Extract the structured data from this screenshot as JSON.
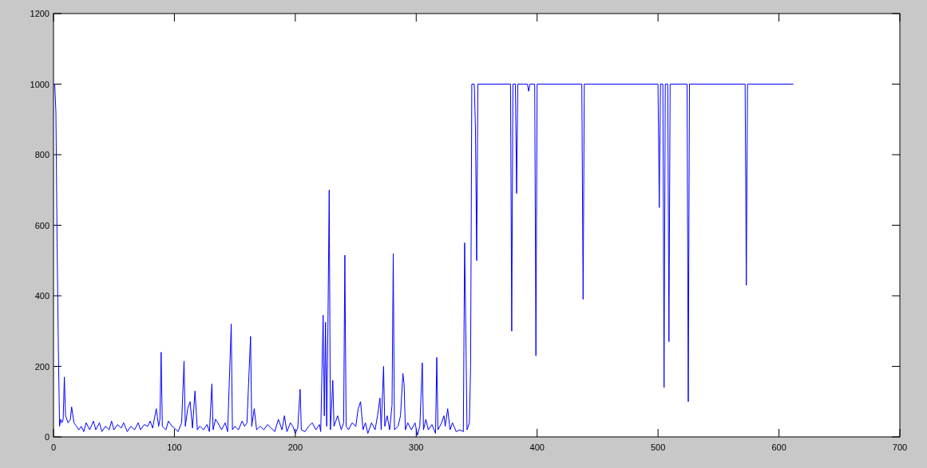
{
  "figure": {
    "chart_data": {
      "type": "line",
      "xlim": [
        0,
        700
      ],
      "ylim": [
        0,
        1200
      ],
      "xticks": [
        0,
        100,
        200,
        300,
        400,
        500,
        600,
        700
      ],
      "yticks": [
        0,
        200,
        400,
        600,
        800,
        1000,
        1200
      ],
      "x": [
        0,
        1,
        2,
        3,
        4,
        5,
        6,
        7,
        8,
        9,
        10,
        12,
        14,
        15,
        17,
        19,
        21,
        23,
        25,
        27,
        30,
        33,
        35,
        38,
        40,
        43,
        46,
        48,
        50,
        53,
        56,
        58,
        61,
        64,
        67,
        70,
        72,
        75,
        78,
        80,
        82,
        85,
        87,
        88,
        89,
        90,
        93,
        95,
        98,
        100,
        103,
        106,
        108,
        109,
        111,
        113,
        115,
        117,
        119,
        121,
        124,
        127,
        129,
        131,
        132,
        134,
        136,
        139,
        142,
        144,
        147,
        148,
        150,
        153,
        156,
        158,
        160,
        163,
        164,
        166,
        168,
        171,
        174,
        177,
        180,
        183,
        186,
        189,
        191,
        193,
        196,
        198,
        200,
        202,
        204,
        205,
        208,
        211,
        214,
        217,
        220,
        221,
        223,
        224,
        225,
        226,
        227,
        228,
        229,
        231,
        232,
        235,
        238,
        240,
        241,
        242,
        244,
        247,
        250,
        252,
        254,
        256,
        258,
        260,
        263,
        266,
        268,
        270,
        271,
        273,
        274,
        276,
        278,
        280,
        281,
        282,
        285,
        287,
        289,
        290,
        291,
        293,
        296,
        299,
        301,
        303,
        305,
        306,
        308,
        310,
        313,
        316,
        317,
        318,
        321,
        323,
        324,
        326,
        328,
        330,
        333,
        336,
        339,
        340,
        341,
        342,
        344,
        345,
        346,
        348,
        349,
        350,
        351,
        378,
        379,
        380,
        382,
        383,
        384,
        392,
        393,
        394,
        398,
        399,
        400,
        437,
        438,
        439,
        500,
        501,
        502,
        504,
        505,
        506,
        508,
        509,
        510,
        524,
        525,
        526,
        572,
        573,
        574,
        612
      ],
      "series": [
        {
          "color": "#0000ff",
          "values": [
            1000,
            1000,
            920,
            550,
            250,
            30,
            50,
            40,
            50,
            170,
            60,
            40,
            50,
            85,
            40,
            30,
            20,
            30,
            15,
            40,
            20,
            45,
            20,
            40,
            15,
            30,
            20,
            45,
            20,
            35,
            25,
            40,
            15,
            30,
            20,
            40,
            20,
            35,
            30,
            45,
            25,
            80,
            30,
            50,
            240,
            30,
            20,
            45,
            30,
            25,
            15,
            40,
            215,
            30,
            80,
            100,
            25,
            130,
            20,
            30,
            20,
            35,
            15,
            150,
            20,
            50,
            40,
            20,
            40,
            15,
            320,
            20,
            30,
            20,
            45,
            30,
            40,
            285,
            30,
            80,
            20,
            30,
            20,
            35,
            25,
            15,
            50,
            20,
            60,
            15,
            40,
            30,
            10,
            25,
            135,
            20,
            15,
            30,
            40,
            20,
            35,
            15,
            345,
            60,
            325,
            30,
            310,
            700,
            20,
            160,
            30,
            60,
            20,
            40,
            515,
            30,
            20,
            40,
            30,
            80,
            100,
            20,
            40,
            10,
            40,
            20,
            60,
            110,
            20,
            200,
            30,
            60,
            20,
            90,
            520,
            20,
            30,
            60,
            180,
            150,
            20,
            40,
            20,
            40,
            5,
            30,
            210,
            20,
            50,
            20,
            35,
            10,
            225,
            20,
            40,
            60,
            30,
            80,
            20,
            40,
            15,
            20,
            15,
            550,
            300,
            20,
            40,
            200,
            1000,
            1000,
            870,
            500,
            1000,
            1000,
            300,
            1000,
            1000,
            690,
            1000,
            1000,
            980,
            1000,
            1000,
            230,
            1000,
            1000,
            390,
            1000,
            1000,
            650,
            1000,
            1000,
            140,
            1000,
            1000,
            270,
            1000,
            1000,
            100,
            1000,
            1000,
            430,
            1000,
            1000
          ]
        }
      ]
    }
  }
}
